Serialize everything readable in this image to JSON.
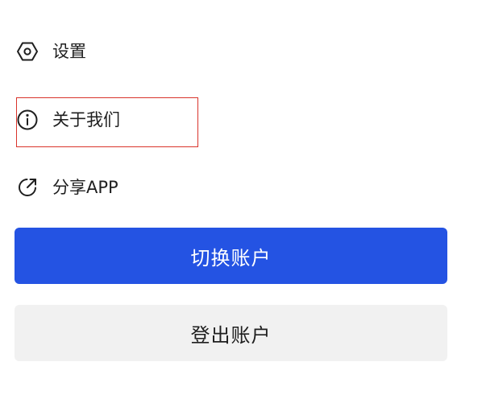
{
  "menu": {
    "items": [
      {
        "label": "设置",
        "icon": "settings-hexagon-icon"
      },
      {
        "label": "关于我们",
        "icon": "info-circle-icon"
      },
      {
        "label": "分享APP",
        "icon": "share-external-icon"
      }
    ]
  },
  "buttons": {
    "switch_account_label": "切换账户",
    "logout_label": "登出账户"
  },
  "colors": {
    "primary_button": "#2453e3",
    "secondary_button": "#f1f1f1",
    "highlight_border": "#d9342b",
    "text": "#1f1f1f"
  }
}
